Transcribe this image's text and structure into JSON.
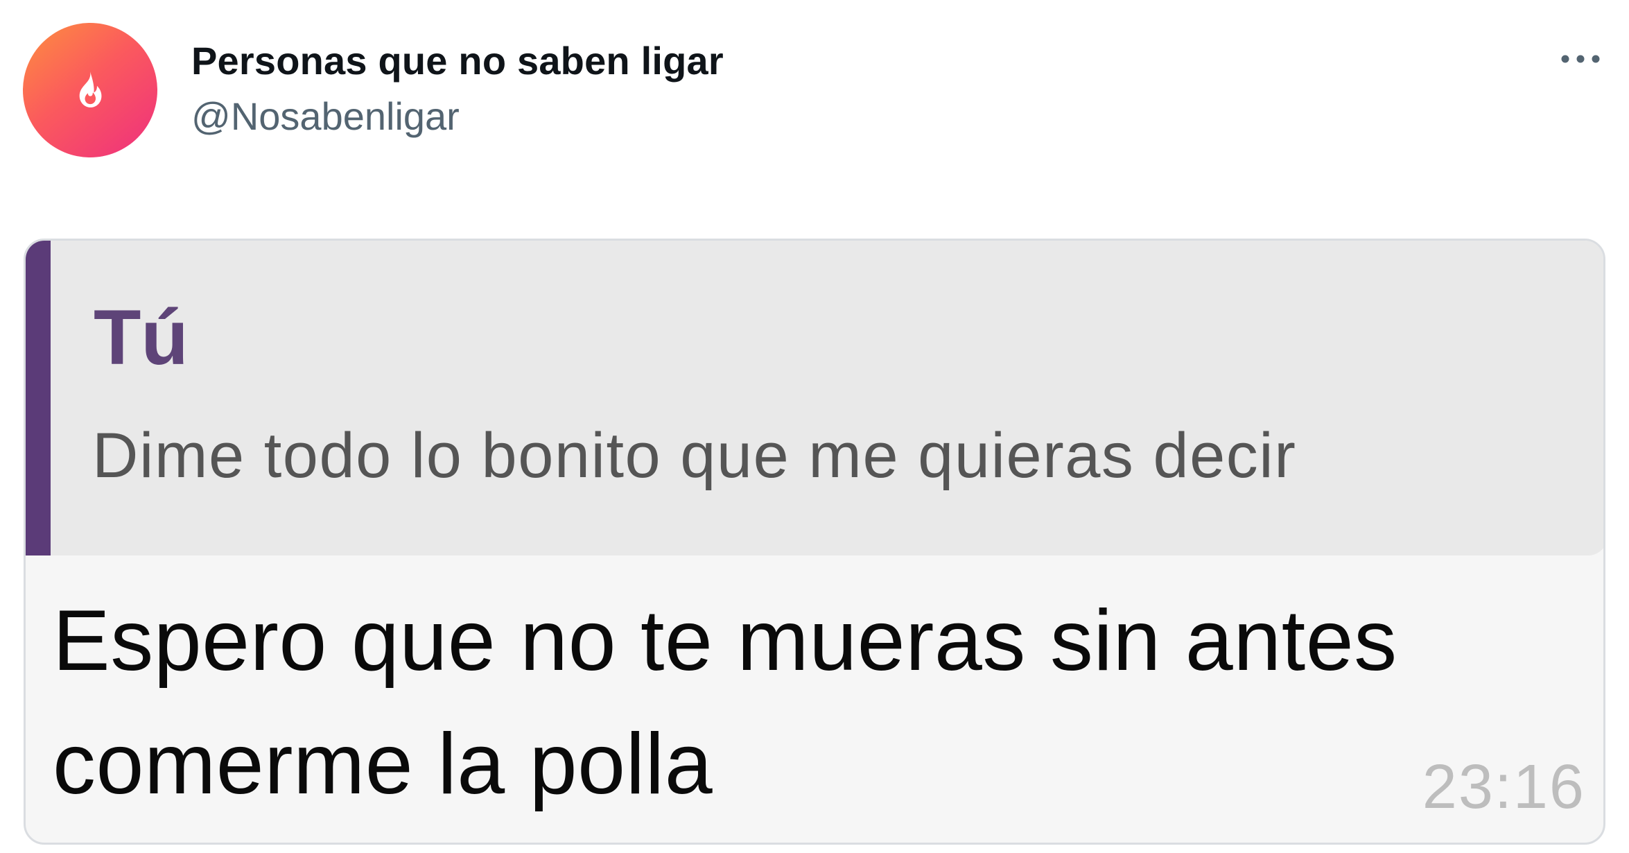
{
  "tweet": {
    "account": {
      "display_name": "Personas que no saben ligar",
      "handle": "@Nosabenligar",
      "avatar_icon": "flame-icon",
      "avatar_colors": [
        "#fd8f3f",
        "#fb5a5d",
        "#ee2f7e"
      ]
    },
    "more_icon": "more-horizontal-icon"
  },
  "message": {
    "quoted": {
      "author": "Tú",
      "text": "Dime todo lo bonito que me quieras decir",
      "accent_color": "#5b3b78"
    },
    "reply": {
      "text": "Espero que no te mueras sin antes\ncomerme la polla",
      "time": "23:16"
    }
  }
}
